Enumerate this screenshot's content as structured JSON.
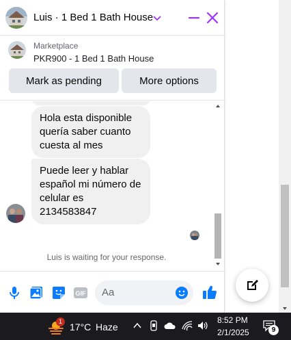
{
  "chat": {
    "title": "Luis · 1 Bed 1 Bath House",
    "listing": {
      "source": "Marketplace",
      "name": "PKR900 - 1 Bed 1 Bath House",
      "pending_label": "Mark as pending",
      "more_label": "More options"
    },
    "messages": [
      {
        "text": "Hola esta disponible quería saber cuanto cuesta al mes"
      },
      {
        "text": "Puede leer y hablar español  mi número de celular es 2134583847"
      }
    ],
    "waiting_text": "Luis is waiting for your response.",
    "composer": {
      "placeholder": "Aa"
    },
    "accent_color": "#a033ff",
    "icon_color": "#0a7cff"
  },
  "taskbar": {
    "weather_badge": "1",
    "temperature": "17°C",
    "condition": "Haze",
    "time": "8:52 PM",
    "date": "2/1/2025",
    "notifications": "9"
  }
}
